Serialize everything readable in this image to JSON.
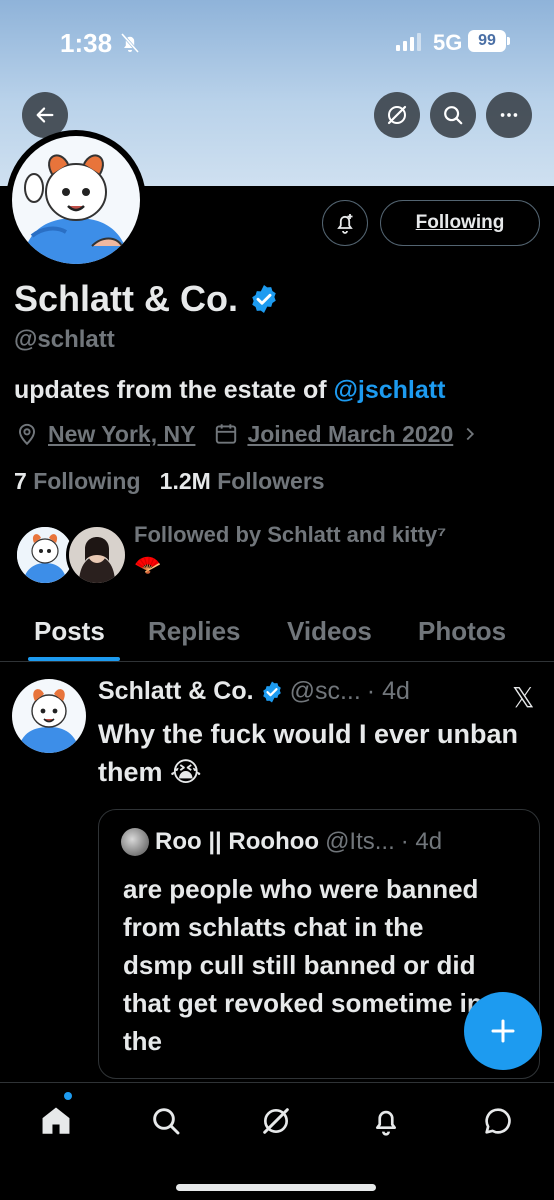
{
  "status_bar": {
    "time": "1:38",
    "network": "5G",
    "battery": "99"
  },
  "profile": {
    "display_name": "Schlatt & Co.",
    "handle": "@schlatt",
    "bio_text": "updates from the estate of ",
    "bio_mention": "@jschlatt",
    "location": "New York, NY",
    "joined": "Joined March 2020",
    "following_count": "7",
    "following_label": "Following",
    "followers_count": "1.2M",
    "followers_label": "Followers",
    "followed_by": "Followed by Schlatt and kitty⁷",
    "followed_by_emoji": "🪭",
    "follow_button_label": "Following"
  },
  "tabs": [
    {
      "label": "Posts",
      "active": true
    },
    {
      "label": "Replies",
      "active": false
    },
    {
      "label": "Videos",
      "active": false
    },
    {
      "label": "Photos",
      "active": false
    }
  ],
  "post": {
    "name": "Schlatt & Co.",
    "handle": "@sc...",
    "time": "· 4d",
    "text": "Why the fuck would I ever unban them 😭",
    "quote": {
      "name": "Roo || Roohoo",
      "handle": "@Its...",
      "time": "· 4d",
      "text": "are people who were banned from schlatts chat in the dsmp cull still banned or did that get revoked sometime in the"
    }
  },
  "colors": {
    "accent": "#1d9bf0",
    "background": "#000000",
    "text_primary": "#e7e9ea",
    "text_secondary": "#71767b",
    "divider": "#2f3336"
  },
  "icons": [
    "back-arrow-icon",
    "grok-icon",
    "search-icon",
    "more-icon",
    "bell-plus-icon",
    "verified-badge-icon",
    "location-icon",
    "calendar-icon",
    "x-logo-icon",
    "plus-icon",
    "home-icon",
    "explore-icon",
    "notifications-icon",
    "messages-icon"
  ]
}
